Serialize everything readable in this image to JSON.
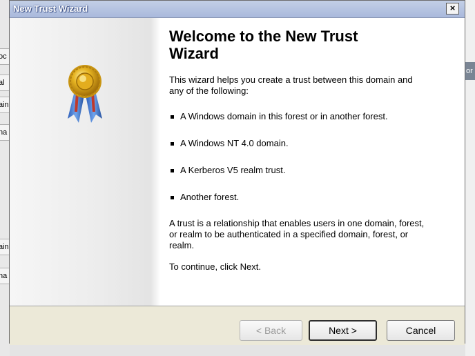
{
  "window": {
    "title": "New Trust Wizard",
    "close_label": "×"
  },
  "background_app": {
    "left_fragments": [
      "oc",
      "al",
      "ain",
      "na",
      "ain",
      "na"
    ],
    "right_fragment": "or"
  },
  "content": {
    "heading": "Welcome to the New Trust Wizard",
    "intro": "This wizard helps you create a trust between this domain and any of the following:",
    "bullets": [
      "A Windows domain in this forest or in another forest.",
      "A Windows NT 4.0 domain.",
      "A Kerberos V5 realm trust.",
      "Another forest."
    ],
    "definition": "A trust is a relationship that enables users in one domain, forest, or realm to be authenticated in a specified domain, forest, or realm.",
    "continue_text": "To continue, click Next."
  },
  "buttons": {
    "back": "< Back",
    "next": "Next >",
    "cancel": "Cancel"
  },
  "icons": {
    "badge": "award-ribbon-icon"
  }
}
